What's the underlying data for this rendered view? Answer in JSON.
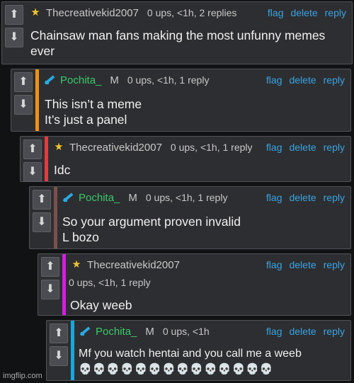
{
  "comments": [
    {
      "user": "Thecreativekid2007",
      "meta": "0 ups, <1h, 2 replies",
      "mod": "",
      "actions": [
        "flag",
        "delete",
        "reply"
      ],
      "lines": [
        "Chainsaw man fans making the most unfunny memes",
        "ever"
      ],
      "bar_color": ""
    },
    {
      "user": "Pochita_",
      "meta": "0 ups, <1h, 1 reply",
      "mod": "M",
      "actions": [
        "flag",
        "delete",
        "reply"
      ],
      "lines": [
        "This isn’t a meme",
        "It’s just a panel"
      ],
      "bar_color": "#f2910f"
    },
    {
      "user": "Thecreativekid2007",
      "meta": "0 ups, <1h, 1 reply",
      "mod": "",
      "actions": [
        "flag",
        "delete",
        "reply"
      ],
      "lines": [
        "Idc"
      ],
      "bar_color": "#e33b3b"
    },
    {
      "user": "Pochita_",
      "meta": "0 ups, <1h, 1 reply",
      "mod": "M",
      "actions": [
        "flag",
        "delete",
        "reply"
      ],
      "lines": [
        "So your argument proven invalid",
        "L bozo"
      ],
      "bar_color": "#7d4e4a"
    },
    {
      "user": "Thecreativekid2007",
      "meta": "0 ups, <1h, 1 reply",
      "mod": "",
      "actions": [
        "flag",
        "delete",
        "reply"
      ],
      "lines": [
        "Okay weeb"
      ],
      "bar_color": "#d51de0"
    },
    {
      "user": "Pochita_",
      "meta": "0 ups, <1h",
      "mod": "M",
      "actions": [
        "flag",
        "delete",
        "reply"
      ],
      "lines": [
        "Mf you watch hentai and you call me a weeb",
        "💀💀💀💀💀💀💀💀💀💀💀💀💀💀"
      ],
      "bar_color": "#1aa7dc"
    }
  ],
  "icons": {
    "upvote": "up-arrow-icon",
    "downvote": "down-arrow-icon"
  },
  "watermark": "imgflip.com"
}
